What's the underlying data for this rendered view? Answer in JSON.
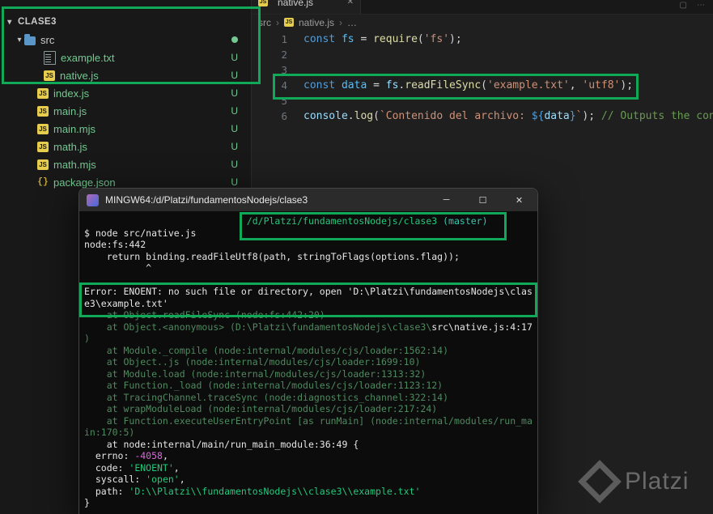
{
  "colors": {
    "annotation": "#0fa958",
    "untracked": "#73c991",
    "terminal_green": "#23c97c",
    "terminal_dim": "#4d8a5f",
    "terminal_magenta": "#d86ad8"
  },
  "glyphs": {
    "chevron_down": "▾",
    "breadcrumb_sep": "›",
    "more": "…",
    "tab_close": "✕"
  },
  "explorer": {
    "root": {
      "label": "CLASE3"
    },
    "items": [
      {
        "name": "src",
        "kind": "folder",
        "level": 1,
        "dot": true
      },
      {
        "name": "example.txt",
        "kind": "txt",
        "level": 2,
        "badge": "U"
      },
      {
        "name": "native.js",
        "kind": "js",
        "level": 2,
        "badge": "U"
      },
      {
        "name": "index.js",
        "kind": "js",
        "level": 1,
        "badge": "U"
      },
      {
        "name": "main.js",
        "kind": "js",
        "level": 1,
        "badge": "U"
      },
      {
        "name": "main.mjs",
        "kind": "js",
        "level": 1,
        "badge": "U"
      },
      {
        "name": "math.js",
        "kind": "js",
        "level": 1,
        "badge": "U"
      },
      {
        "name": "math.mjs",
        "kind": "js",
        "level": 1,
        "badge": "U"
      },
      {
        "name": "package.json",
        "kind": "json",
        "level": 1,
        "badge": "U"
      }
    ]
  },
  "editor": {
    "tab": {
      "label": "native.js"
    },
    "breadcrumb": [
      "src",
      "native.js",
      "…"
    ],
    "lines": [
      {
        "n": "1",
        "toks": [
          [
            "const",
            "kw"
          ],
          [
            " ",
            "pu"
          ],
          [
            "fs",
            "vr"
          ],
          [
            " = ",
            "pu"
          ],
          [
            "require",
            "fn"
          ],
          [
            "(",
            "pu"
          ],
          [
            "'fs'",
            "st"
          ],
          [
            ");",
            "pu"
          ]
        ]
      },
      {
        "n": "2",
        "toks": []
      },
      {
        "n": "3",
        "toks": []
      },
      {
        "n": "4",
        "toks": [
          [
            "const",
            "kw"
          ],
          [
            " ",
            "pu"
          ],
          [
            "data",
            "vr"
          ],
          [
            " = ",
            "pu"
          ],
          [
            "fs",
            "ob"
          ],
          [
            ".",
            "pu"
          ],
          [
            "readFileSync",
            "fn"
          ],
          [
            "(",
            "pu"
          ],
          [
            "'example.txt'",
            "st"
          ],
          [
            ", ",
            "pu"
          ],
          [
            "'utf8'",
            "st"
          ],
          [
            ");",
            "pu"
          ]
        ]
      },
      {
        "n": "5",
        "toks": []
      },
      {
        "n": "6",
        "toks": [
          [
            "console",
            "ob"
          ],
          [
            ".",
            "pu"
          ],
          [
            "log",
            "fn"
          ],
          [
            "(",
            "pu"
          ],
          [
            "`Contenido del archivo: ",
            "st"
          ],
          [
            "${",
            "tp"
          ],
          [
            "data",
            "ob"
          ],
          [
            "}",
            "tp"
          ],
          [
            "`",
            "st"
          ],
          [
            "); ",
            "pu"
          ],
          [
            "// Outputs the cont",
            "cm"
          ]
        ]
      }
    ]
  },
  "terminal": {
    "title": "MINGW64:/d/Platzi/fundamentosNodejs/clase3",
    "controls": {
      "minimize": "─",
      "maximize": "☐",
      "close": "✕"
    },
    "lines": [
      {
        "pad": 29,
        "toks": [
          [
            "/d/Platzi/fundamentosNodejs/clase3 ",
            "grn"
          ],
          [
            "(master)",
            "cyn"
          ]
        ]
      },
      {
        "toks": [
          [
            "$ node src/native.js",
            "wh"
          ]
        ]
      },
      {
        "toks": [
          [
            "node:fs:442",
            "wh"
          ]
        ]
      },
      {
        "toks": [
          [
            "    return binding.readFileUtf8(path, stringToFlags(options.flag));",
            "wh"
          ]
        ]
      },
      {
        "toks": [
          [
            "           ^",
            "wh"
          ]
        ]
      },
      {
        "toks": []
      },
      {
        "toks": [
          [
            "Error: ENOENT: no such file or directory, open 'D:\\Platzi\\fundamentosNodejs\\clas",
            "wh"
          ]
        ]
      },
      {
        "toks": [
          [
            "e3\\example.txt'",
            "wh"
          ]
        ]
      },
      {
        "toks": [
          [
            "    at Object.readFileSync (node:fs:442:20)",
            "dim"
          ]
        ]
      },
      {
        "toks": [
          [
            "    at Object.<anonymous> (D:\\Platzi\\fundamentosNodejs\\clase3\\",
            "dim"
          ],
          [
            "src\\native.js:4:17",
            "wh"
          ]
        ]
      },
      {
        "toks": [
          [
            ")",
            "dim"
          ]
        ]
      },
      {
        "toks": [
          [
            "    at Module._compile (node:internal/modules/cjs/loader:1562:14)",
            "dim"
          ]
        ]
      },
      {
        "toks": [
          [
            "    at Object..js (node:internal/modules/cjs/loader:1699:10)",
            "dim"
          ]
        ]
      },
      {
        "toks": [
          [
            "    at Module.load (node:internal/modules/cjs/loader:1313:32)",
            "dim"
          ]
        ]
      },
      {
        "toks": [
          [
            "    at Function._load (node:internal/modules/cjs/loader:1123:12)",
            "dim"
          ]
        ]
      },
      {
        "toks": [
          [
            "    at TracingChannel.traceSync (node:diagnostics_channel:322:14)",
            "dim"
          ]
        ]
      },
      {
        "toks": [
          [
            "    at wrapModuleLoad (node:internal/modules/cjs/loader:217:24)",
            "dim"
          ]
        ]
      },
      {
        "toks": [
          [
            "    at Function.executeUserEntryPoint [as runMain] (node:internal/modules/run_ma",
            "dim"
          ]
        ]
      },
      {
        "toks": [
          [
            "in:170:5)",
            "dim"
          ]
        ]
      },
      {
        "toks": [
          [
            "    at node:internal/main/run_main_module:36:49 {",
            "wh"
          ]
        ]
      },
      {
        "toks": [
          [
            "  errno: ",
            "wh"
          ],
          [
            "-4058",
            "mag"
          ],
          [
            ",",
            "wh"
          ]
        ]
      },
      {
        "toks": [
          [
            "  code: ",
            "wh"
          ],
          [
            "'ENOENT'",
            "grn"
          ],
          [
            ",",
            "wh"
          ]
        ]
      },
      {
        "toks": [
          [
            "  syscall: ",
            "wh"
          ],
          [
            "'open'",
            "grn"
          ],
          [
            ",",
            "wh"
          ]
        ]
      },
      {
        "toks": [
          [
            "  path: ",
            "wh"
          ],
          [
            "'D:\\\\Platzi\\\\fundamentosNodejs\\\\clase3\\\\example.txt'",
            "grn"
          ]
        ]
      },
      {
        "toks": [
          [
            "}",
            "wh"
          ]
        ]
      }
    ]
  },
  "watermark": {
    "text": "Platzi"
  }
}
